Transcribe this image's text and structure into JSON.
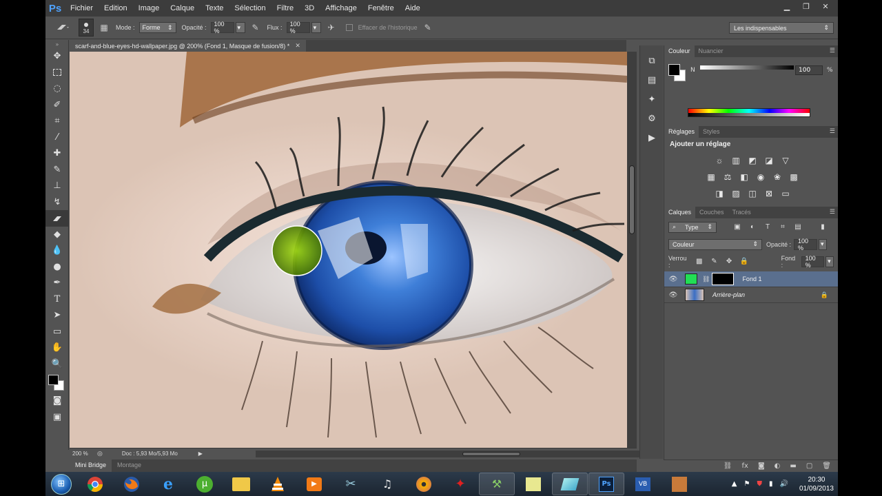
{
  "app": {
    "logo": "Ps",
    "menu": [
      "Fichier",
      "Edition",
      "Image",
      "Calque",
      "Texte",
      "Sélection",
      "Filtre",
      "3D",
      "Affichage",
      "Fenêtre",
      "Aide"
    ],
    "window_controls": {
      "minimize": "▁",
      "restore": "❐",
      "close": "✕"
    }
  },
  "options_bar": {
    "brush_size": "34",
    "mode_label": "Mode :",
    "mode_value": "Forme",
    "opacity_label": "Opacité :",
    "opacity_value": "100 %",
    "flow_label": "Flux :",
    "flow_value": "100 %",
    "history_label": "Effacer de l'historique",
    "workspace": "Les indispensables"
  },
  "document": {
    "tab_title": "scarf-and-blue-eyes-hd-wallpaper.jpg @ 200% (Fond 1, Masque de fusion/8) *",
    "zoom": "200 %",
    "doc_info": "Doc : 5,93 Mo/5,93 Mo"
  },
  "bottom_tabs": [
    "Mini Bridge",
    "Montage"
  ],
  "color_panel": {
    "tabs": [
      "Couleur",
      "Nuancier"
    ],
    "channel": "N",
    "value": "100",
    "unit": "%",
    "fg_color": "#000000",
    "bg_color": "#ffffff"
  },
  "adjust_panel": {
    "tabs": [
      "Réglages",
      "Styles"
    ],
    "title": "Ajouter un réglage"
  },
  "layers_panel": {
    "tabs": [
      "Calques",
      "Couches",
      "Tracés"
    ],
    "filter": "Type",
    "blend_mode": "Couleur",
    "opacity_label": "Opacité :",
    "opacity_value": "100 %",
    "lock_label": "Verrou :",
    "fill_label": "Fond :",
    "fill_value": "100 %",
    "layers": [
      {
        "name": "Fond 1",
        "selected": true,
        "fill_color": "#22dd55"
      },
      {
        "name": "Arrière-plan",
        "selected": false
      }
    ]
  },
  "taskbar": {
    "time": "20:30",
    "date": "01/09/2013"
  },
  "colors": {
    "accent_highlight": "#5a6f8e",
    "brush_overlay": "#7fbf00"
  }
}
